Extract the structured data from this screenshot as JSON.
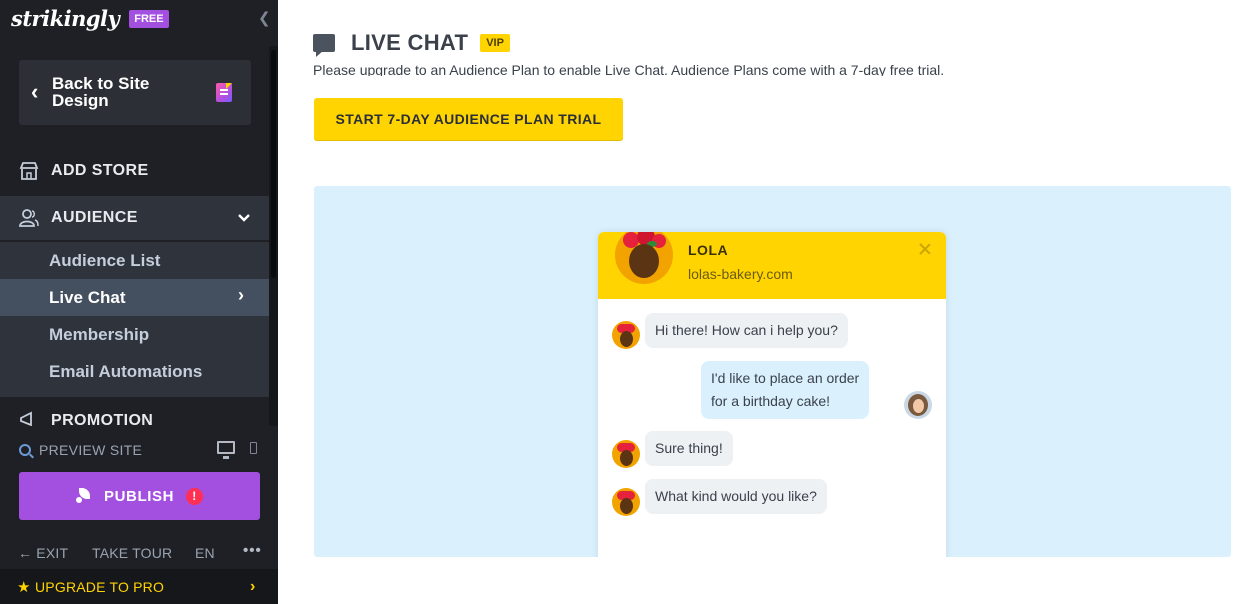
{
  "sidebar": {
    "brand": "strikingly",
    "plan_badge": "FREE",
    "back_label": "Back to Site Design",
    "nav": {
      "add_store": "ADD STORE",
      "audience": "AUDIENCE",
      "promotion": "PROMOTION"
    },
    "audience_items": [
      {
        "label": "Audience List"
      },
      {
        "label": "Live Chat"
      },
      {
        "label": "Membership"
      },
      {
        "label": "Email Automations"
      }
    ],
    "preview_label": "PREVIEW SITE",
    "publish_label": "PUBLISH",
    "publish_alert": "!",
    "footer": {
      "exit": "← EXIT",
      "take_tour": "TAKE TOUR",
      "language": "EN",
      "more": "•••"
    },
    "upgrade_label": "UPGRADE TO PRO"
  },
  "main": {
    "title": "LIVE CHAT",
    "badge": "VIP",
    "upgrade_message": "Please upgrade to an Audience Plan to enable Live Chat. Audience Plans come with a 7-day free trial.",
    "trial_button": "START 7-DAY AUDIENCE PLAN TRIAL",
    "chat_preview": {
      "agent_name": "LOLA",
      "agent_site": "lolas-bakery.com",
      "messages": [
        {
          "from": "agent",
          "text": "Hi there! How can i help you?"
        },
        {
          "from": "visitor",
          "lines": [
            "I'd like to place an order",
            "for a birthday cake!"
          ]
        },
        {
          "from": "agent",
          "text": "Sure thing!"
        },
        {
          "from": "agent",
          "text": "What kind would you like?"
        }
      ]
    }
  },
  "colors": {
    "sidebar_bg": "#1e2026",
    "accent_purple": "#a34fe0",
    "accent_yellow": "#ffd400",
    "preview_bg": "#daf1fd"
  },
  "icons": [
    "collapse-chevron-icon",
    "back-chevron-icon",
    "page-design-icon",
    "store-icon",
    "audience-icon",
    "chevron-down-icon",
    "chevron-right-icon",
    "megaphone-icon",
    "search-icon",
    "desktop-icon",
    "mobile-icon",
    "rocket-icon",
    "star-icon",
    "chat-bubble-icon",
    "close-icon"
  ]
}
